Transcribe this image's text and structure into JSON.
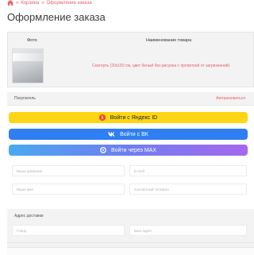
{
  "breadcrumb": {
    "items": [
      "Корзина",
      "Оформление заказа"
    ],
    "separator": "»"
  },
  "page": {
    "title": "Оформление заказа"
  },
  "order_table": {
    "headers": {
      "photo": "Фото",
      "name": "Наименование товара"
    },
    "rows": [
      {
        "name": "Скатерть (20x160 см, цвет белый без рисунка с пропиткой от загрязнений)"
      }
    ]
  },
  "buyer": {
    "label": "Покупатель",
    "login_link": "Авторизоваться"
  },
  "auth": {
    "yandex_label": "Войти с Яндекс ID",
    "vk_label": "Войти с ВК",
    "max_label": "Войти через MAX"
  },
  "form": {
    "surname_placeholder": "Ваша фамилия",
    "email_placeholder": "E-mail",
    "name_placeholder": "Ваше имя",
    "phone_placeholder": "Контактный телефон"
  },
  "delivery": {
    "label": "Адрес доставки",
    "city_placeholder": "Город",
    "address_placeholder": "Ваш адрес"
  },
  "colors": {
    "accent": "#e8616a",
    "yandex": "#fcd614",
    "vk": "#2f7ef2",
    "max_gradient_start": "#4aa8f0",
    "max_gradient_end": "#a667ee"
  },
  "icons": [
    "home-icon",
    "yandex-icon",
    "vk-icon",
    "max-icon"
  ]
}
